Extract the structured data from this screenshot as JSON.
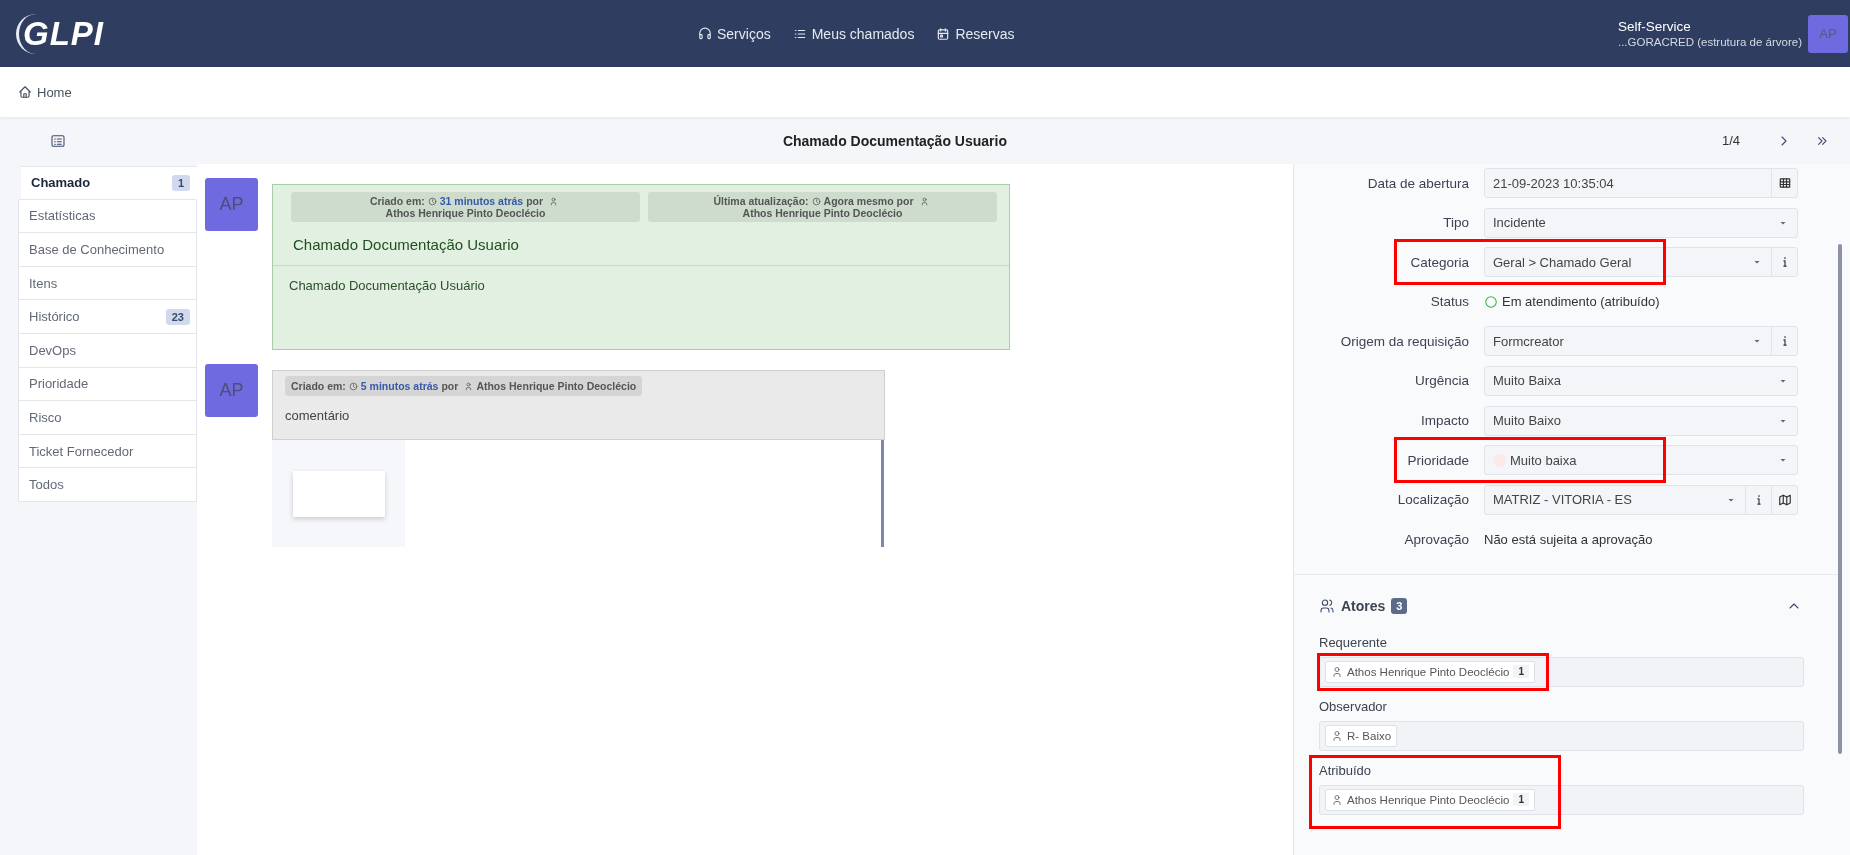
{
  "header": {
    "logo": "GLPI",
    "nav": [
      {
        "label": "Serviços"
      },
      {
        "label": "Meus chamados"
      },
      {
        "label": "Reservas"
      }
    ],
    "user": {
      "profile": "Self-Service",
      "entity": "...GORACRED (estrutura de árvore)",
      "initials": "AP"
    }
  },
  "breadcrumb": [
    {
      "label": "Home"
    }
  ],
  "title_bar": {
    "title": "Chamado Documentação Usuario",
    "pager": "1/4"
  },
  "tabs": [
    {
      "label": "Chamado",
      "selected": true,
      "count": "1"
    },
    {
      "label": "Estatísticas",
      "selected": false
    },
    {
      "label": "Base de Conhecimento",
      "selected": false
    },
    {
      "label": "Itens",
      "selected": false
    },
    {
      "label": "Histórico",
      "selected": false,
      "count": "23"
    },
    {
      "label": "DevOps",
      "selected": false
    },
    {
      "label": "Prioridade",
      "selected": false
    },
    {
      "label": "Risco",
      "selected": false
    },
    {
      "label": "Ticket Fornecedor",
      "selected": false
    },
    {
      "label": "Todos",
      "selected": false
    }
  ],
  "timeline": [
    {
      "kind": "ticket",
      "initials": "AP",
      "meta": [
        {
          "label": "Criado em:",
          "time": "31 minutos atrás",
          "linked": true,
          "by": "por",
          "author": "Athos Henrique Pinto Deoclécio"
        },
        {
          "label": "Última atualização:",
          "time": "Agora mesmo",
          "linked": false,
          "by": "por",
          "author": "Athos Henrique Pinto Deoclécio"
        }
      ],
      "title": "Chamado Documentação Usuario",
      "content": "Chamado Documentação Usuário"
    },
    {
      "kind": "followup",
      "initials": "AP",
      "meta": [
        {
          "label": "Criado em:",
          "time": "5 minutos atrás",
          "linked": true,
          "by": "por",
          "author": "Athos Henrique Pinto Deoclécio"
        }
      ],
      "content": "comentário",
      "attachment": true
    }
  ],
  "form": {
    "rows": [
      {
        "label": "Data de abertura",
        "kind": "date",
        "value": "21-09-2023 10:35:04",
        "highlighted": false
      },
      {
        "label": "Tipo",
        "kind": "select",
        "value": "Incidente",
        "highlighted": false
      },
      {
        "label": "Categoria",
        "kind": "select",
        "value": "Geral > Chamado Geral",
        "info": true,
        "highlighted": true
      },
      {
        "label": "Status",
        "kind": "status",
        "value": "Em atendimento (atribuído)",
        "highlighted": false
      },
      {
        "label": "Origem da requisição",
        "kind": "select",
        "value": "Formcreator",
        "info": true,
        "highlighted": false
      },
      {
        "label": "Urgência",
        "kind": "select",
        "value": "Muito Baixa",
        "highlighted": false
      },
      {
        "label": "Impacto",
        "kind": "select",
        "value": "Muito Baixo",
        "highlighted": false
      },
      {
        "label": "Prioridade",
        "kind": "select",
        "value": "Muito baixa",
        "color": "#fde9ea",
        "highlighted": true
      },
      {
        "label": "Localização",
        "kind": "select",
        "value": "MATRIZ - VITORIA - ES",
        "info": true,
        "map": true,
        "highlighted": false
      },
      {
        "label": "Aprovação",
        "kind": "text",
        "value": "Não está sujeita a aprovação",
        "highlighted": false
      }
    ]
  },
  "actors": {
    "title": "Atores",
    "count": "3",
    "expanded": true,
    "groups": [
      {
        "label": "Requerente",
        "highlighted": false,
        "value_highlighted": true,
        "items": [
          {
            "name": "Athos Henrique Pinto Deoclécio",
            "count": "1"
          }
        ]
      },
      {
        "label": "Observador",
        "highlighted": false,
        "value_highlighted": false,
        "items": [
          {
            "name": "R- Baixo"
          }
        ]
      },
      {
        "label": "Atribuído",
        "highlighted": true,
        "value_highlighted": false,
        "items": [
          {
            "name": "Athos Henrique Pinto Deoclécio",
            "count": "1"
          }
        ]
      }
    ]
  }
}
